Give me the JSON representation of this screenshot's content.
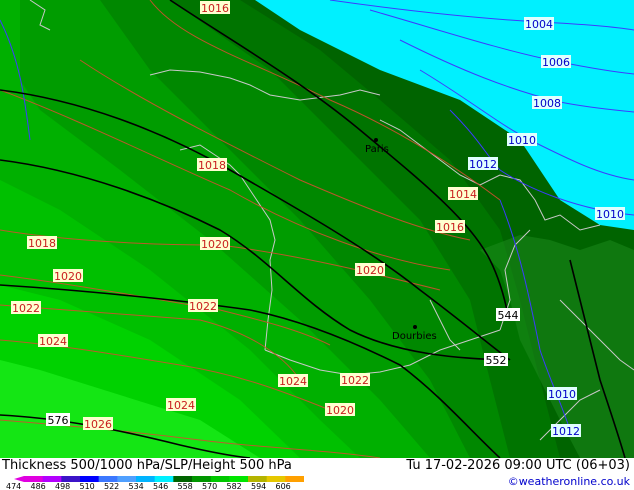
{
  "footer": {
    "title": "Thickness 500/1000 hPa/SLP/Height 500 hPa",
    "datetime": "Tu 17-02-2026 09:00 UTC (06+03)",
    "credit": "©weatheronline.co.uk"
  },
  "scale": {
    "ticks": [
      "474",
      "486",
      "498",
      "510",
      "522",
      "534",
      "546",
      "558",
      "570",
      "582",
      "594",
      "606"
    ],
    "colors": [
      "#e000e0",
      "#b400ff",
      "#3c14c8",
      "#0000ff",
      "#3c78ff",
      "#50a0ff",
      "#00b4ff",
      "#00f0ff",
      "#006400",
      "#009600",
      "#00c800",
      "#00e600",
      "#b4b400",
      "#e6c800",
      "#ffa000"
    ]
  },
  "cities": [
    {
      "name": "Paris"
    },
    {
      "name": "Dourbies"
    }
  ],
  "isobar_labels": [
    {
      "text": "1016",
      "color": "red"
    },
    {
      "text": "1004",
      "color": "blue"
    },
    {
      "text": "1006",
      "color": "blue"
    },
    {
      "text": "1008",
      "color": "blue"
    },
    {
      "text": "1010",
      "color": "blue"
    },
    {
      "text": "1012",
      "color": "blue"
    },
    {
      "text": "1018",
      "color": "red"
    },
    {
      "text": "1014",
      "color": "red"
    },
    {
      "text": "1016",
      "color": "red"
    },
    {
      "text": "1010",
      "color": "blue"
    },
    {
      "text": "1018",
      "color": "red"
    },
    {
      "text": "1020",
      "color": "red"
    },
    {
      "text": "1020",
      "color": "red"
    },
    {
      "text": "1020",
      "color": "red"
    },
    {
      "text": "1022",
      "color": "red"
    },
    {
      "text": "1022",
      "color": "red"
    },
    {
      "text": "1024",
      "color": "red"
    },
    {
      "text": "1024",
      "color": "red"
    },
    {
      "text": "1022",
      "color": "red"
    },
    {
      "text": "1024",
      "color": "red"
    },
    {
      "text": "1020",
      "color": "red"
    },
    {
      "text": "1026",
      "color": "red"
    },
    {
      "text": "1010",
      "color": "blue"
    },
    {
      "text": "1012",
      "color": "blue"
    }
  ],
  "height_labels": [
    "544",
    "552",
    "576"
  ]
}
